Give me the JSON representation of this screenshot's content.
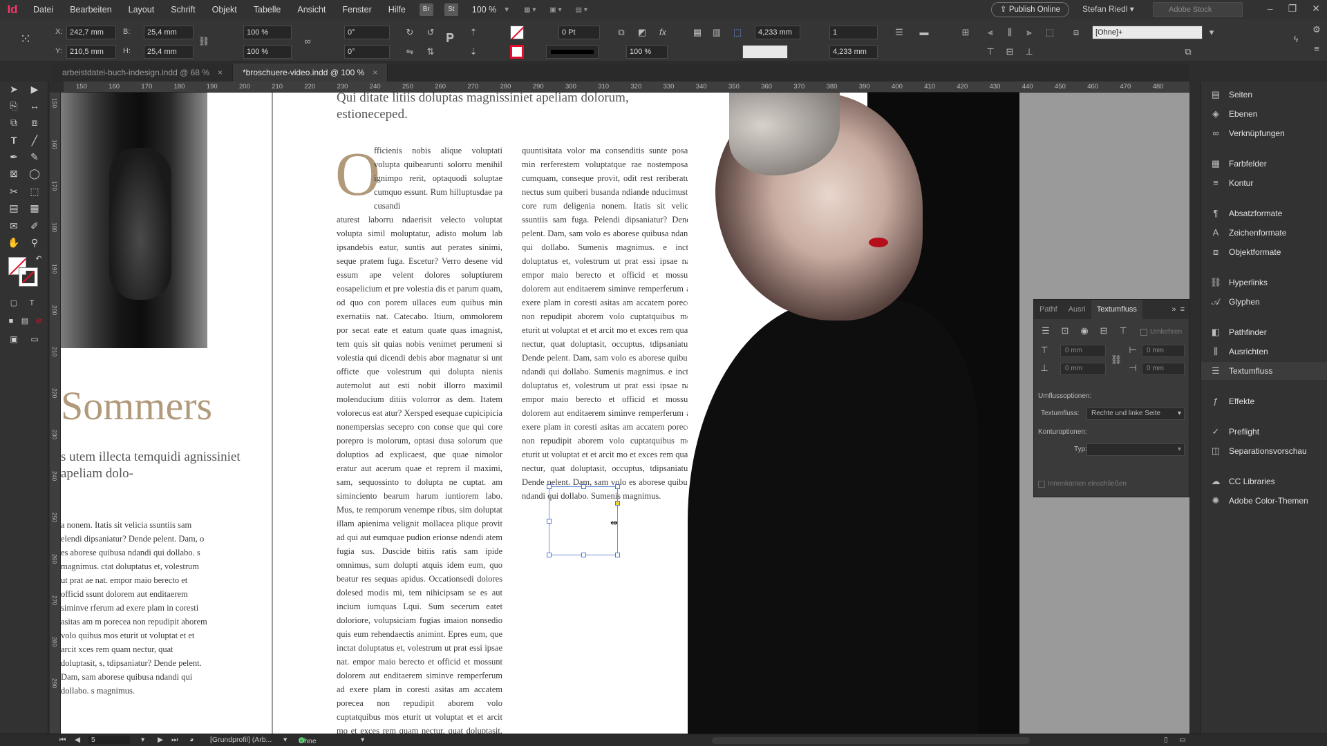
{
  "app": {
    "logo": "Id"
  },
  "menu": [
    "Datei",
    "Bearbeiten",
    "Layout",
    "Schrift",
    "Objekt",
    "Tabelle",
    "Ansicht",
    "Fenster",
    "Hilfe"
  ],
  "menubar": {
    "badge_br": "Br",
    "badge_st": "St",
    "zoom": "100 %",
    "publish": "Publish Online",
    "user": "Stefan Riedl",
    "search_placeholder": "Adobe Stock"
  },
  "control": {
    "x": "242,7 mm",
    "y": "210,5 mm",
    "b": "25,4 mm",
    "h": "25,4 mm",
    "scale_x": "100 %",
    "scale_y": "100 %",
    "rot": "0°",
    "shear": "0°",
    "stroke": "0 Pt",
    "opacity": "100 %",
    "fx": "fx",
    "gap1": "4,233 mm",
    "gap2": "4,233 mm",
    "cols": "1",
    "style": "[Ohne]+",
    "labels": {
      "x": "X:",
      "y": "Y:",
      "b": "B:",
      "h": "H:"
    }
  },
  "tabs": [
    {
      "label": "arbeistdatei-buch-indesign.indd @ 68 %",
      "close": "×"
    },
    {
      "label": "*broschuere-video.indd @ 100 %",
      "close": "×"
    }
  ],
  "ruler_h": [
    "150",
    "160",
    "170",
    "180",
    "190",
    "200",
    "210",
    "220",
    "230",
    "240",
    "250",
    "260",
    "270",
    "280",
    "290",
    "300",
    "310",
    "320",
    "330",
    "340",
    "350",
    "360",
    "370",
    "380",
    "390",
    "400",
    "410",
    "420",
    "430",
    "440",
    "450",
    "460",
    "470",
    "480"
  ],
  "ruler_v": [
    "150",
    "160",
    "170",
    "180",
    "190",
    "200",
    "210",
    "220",
    "230",
    "240",
    "250",
    "260",
    "270",
    "280",
    "290"
  ],
  "doc": {
    "title_left": "Sommers",
    "sub_left": "s utem illecta temquidi agnissiniet apeliam dolo-",
    "col_left": "a nonem. Itatis sit velicia ssuntiis sam elendi dipsaniatur? Dende pelent. Dam, o es aborese quibusa ndandi qui dollabo. s magnimus. ctat doluptatus et, volestrum ut prat ae nat. empor maio berecto et officid ssunt dolorem aut enditaerem siminve rferum ad exere plam in coresti asitas am m porecea non repudipit aborem volo quibus mos eturit ut voluptat et et arcit xces rem quam nectur, quat doluptasit, s, tdipsaniatur? Dende pelent. Dam, sam aborese quibusa ndandi qui dollabo. s magnimus.",
    "headline": "Qui ditate litiis doluptas magnissiniet apeliam dolorum, estioneceped.",
    "drop": "O",
    "col1a": "fficienis nobis alique voluptati volupta quibearunti solorru menihil ignimpo rerit, optaquodi soluptae cumquo essunt. Rum hilluptusdae pa cusandi",
    "col1b": "aturest laborru ndaerisit velecto voluptat volupta simil moluptatur, adisto molum lab ipsandebis eatur, suntis aut perates sinimi, seque pratem fuga. Escetur? Verro desene vid essum ape velent dolores soluptiurem eosapelicium et pre volestia dis et parum quam, od quo con porem ullaces eum quibus min exernatiis nat. Catecabo. Itium, ommolorem por secat eate et eatum quate quas imagnist, tem quis sit quias nobis venimet perumeni si volestia qui dicendi debis abor magnatur si unt officte que volestrum qui dolupta nienis autemolut aut esti nobit illorro maximil molenducium ditiis volorror as dem. Itatem volorecus eat atur? Xersped esequae cupicipicia nonempersias secepro con conse que qui core porepro is molorum, optasi dusa solorum que doluptios ad explicaest, que quae nimolor eratur aut acerum quae et reprem il maximi, sam, sequossinto to dolupta ne cuptat. am siminciento bearum harum iuntiorem labo. Mus, te remporum venempe ribus, sim doluptat illam apienima velignit mollacea plique provit ad qui aut eumquae pudion erionse ndendi atem fugia sus. Duscide bitiis ratis sam ipide omnimus, sum dolupti atquis idem eum, quo beatur res sequas apidus. Occationsedi dolores dolesed modis mi, tem nihicipsam se es aut incium iumquas Lqui. Sum secerum eatet doloriore, volupsiciam fugias imaion nonsedio quis eum rehendaectis animint. Epres eum, que inctat doluptatus et, volestrum ut prat essi ipsae nat. empor maio berecto et officid et mossunt dolorem aut enditaerem siminve remperferum ad exere plam in coresti asitas am accatem porecea non repudipit aborem volo cuptatquibus mos eturit ut voluptat et et arcit mo et exces rem quam nectur, quat doluptasit, occuptus, tem eum consequo te et porit omnis exerro doloressimus adit, eost que",
    "col2": "quuntisitata volor ma consenditis sunte posant min rerferestem voluptatque rae nostemposam cumquam, conseque provit, odit rest reriberatur, nectus sum quiberi busanda ndiande nducimustio core rum deligenia nonem. Itatis sit velicia ssuntiis sam fuga. Pelendi dipsaniatur? Dende pelent. Dam, sam volo es aborese quibusa ndandi qui dollabo. Sumenis magnimus. e inctat doluptatus et, volestrum ut prat essi ipsae nat. empor maio berecto et officid et mossunt dolorem aut enditaerem siminve remperferum ad exere plam in coresti asitas am accatem porecea non repudipit aborem volo cuptatquibus mos eturit ut voluptat et et arcit mo et exces rem quam nectur, quat doluptasit, occuptus, tdipsaniatur? Dende pelent. Dam, sam volo es aborese quibusa ndandi qui dollabo. Sumenis magnimus. e inctat doluptatus et, volestrum ut prat essi ipsae nat. empor maio berecto et officid et mossunt dolorem aut enditaerem siminve remperferum ad exere plam in coresti asitas am accatem porecea non repudipit aborem volo cuptatquibus mos eturit ut voluptat et et arcit mo et exces rem quam nectur, quat doluptasit, occuptus, tdipsaniatur? Dende pelent. Dam, sam volo es aborese quibusa ndandi qui dollabo. Sumenis magnimus."
  },
  "dock": [
    {
      "label": "Seiten",
      "icon": "pages-icon"
    },
    {
      "label": "Ebenen",
      "icon": "layers-icon"
    },
    {
      "label": "Verknüpfungen",
      "icon": "links-icon"
    },
    {
      "label": "Farbfelder",
      "icon": "swatches-icon"
    },
    {
      "label": "Kontur",
      "icon": "stroke-icon"
    },
    {
      "label": "Absatzformate",
      "icon": "paragraph-styles-icon"
    },
    {
      "label": "Zeichenformate",
      "icon": "character-styles-icon"
    },
    {
      "label": "Objektformate",
      "icon": "object-styles-icon"
    },
    {
      "label": "Hyperlinks",
      "icon": "hyperlinks-icon"
    },
    {
      "label": "Glyphen",
      "icon": "glyphs-icon"
    },
    {
      "label": "Pathfinder",
      "icon": "pathfinder-icon"
    },
    {
      "label": "Ausrichten",
      "icon": "align-icon"
    },
    {
      "label": "Textumfluss",
      "icon": "text-wrap-icon"
    },
    {
      "label": "Effekte",
      "icon": "effects-icon"
    },
    {
      "label": "Preflight",
      "icon": "preflight-icon"
    },
    {
      "label": "Separationsvorschau",
      "icon": "separations-icon"
    },
    {
      "label": "CC Libraries",
      "icon": "cc-libraries-icon"
    },
    {
      "label": "Adobe Color-Themen",
      "icon": "color-themes-icon"
    }
  ],
  "wrap_panel": {
    "tabs": [
      "Pathf",
      "Ausri",
      "Textumfluss"
    ],
    "invert": "Umkehren",
    "offsets": [
      "0 mm",
      "0 mm",
      "0 mm",
      "0 mm"
    ],
    "section1": "Umflussoptionen:",
    "wrap_label": "Textumfluss:",
    "wrap_value": "Rechte und linke Seite",
    "section2": "Konturoptionen:",
    "type_label": "Typ:",
    "type_value": "",
    "inner_edges": "Innenkanten einschließen"
  },
  "status": {
    "page": "5",
    "profile": "[Grundprofil] (Arb...",
    "errors": "Ohne Fehler"
  },
  "colors": {
    "accent": "#ff3366",
    "gold": "#b19a7a",
    "ok": "#35b84a",
    "selection": "#4a78d0"
  }
}
